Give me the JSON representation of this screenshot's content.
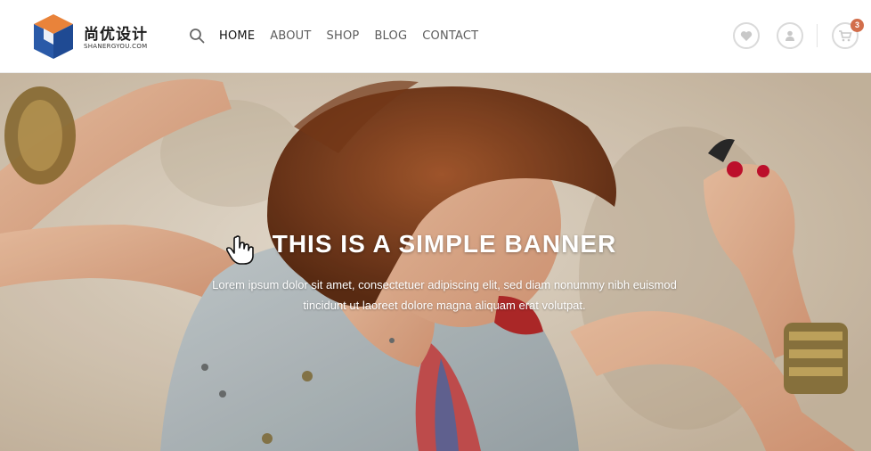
{
  "brand": {
    "name_cn": "尚优设计",
    "name_en": "SHANERGYOU.COM",
    "colors": {
      "blue": "#2a5aa8",
      "orange": "#e9833a"
    }
  },
  "nav": {
    "search_icon": "search-icon",
    "items": [
      {
        "label": "HOME",
        "active": true
      },
      {
        "label": "ABOUT",
        "active": false
      },
      {
        "label": "SHOP",
        "active": false
      },
      {
        "label": "BLOG",
        "active": false
      },
      {
        "label": "CONTACT",
        "active": false
      }
    ]
  },
  "header_actions": {
    "wishlist_icon": "heart-icon",
    "account_icon": "user-icon",
    "cart_icon": "cart-icon",
    "cart_count": "3",
    "badge_color": "#d26e4b"
  },
  "banner": {
    "title": "THIS IS A SIMPLE BANNER",
    "text_line1": "Lorem ipsum dolor sit amet, consectetuer adipiscing elit, sed diam nonummy nibh euismod",
    "text_line2": "tincidunt ut laoreet dolore magna aliquam erat volutpat."
  }
}
